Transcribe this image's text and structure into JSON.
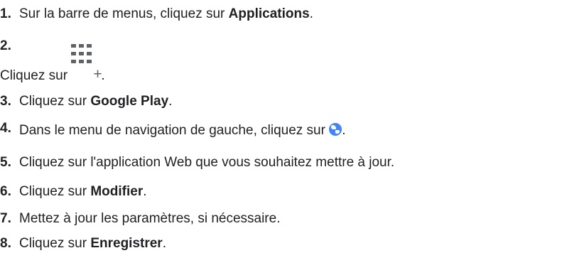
{
  "steps": [
    {
      "num": "1.",
      "pre": "Sur la barre de menus, cliquez sur ",
      "bold": "Applications",
      "post": "."
    },
    {
      "num": "2.",
      "pre": "Cliquez sur ",
      "icon": "apps-grid-plus-icon",
      "post": "."
    },
    {
      "num": "3.",
      "pre": "Cliquez sur ",
      "bold": "Google Play",
      "post": "."
    },
    {
      "num": "4.",
      "pre": "Dans le menu de navigation de gauche, cliquez sur ",
      "icon": "globe-icon",
      "post": "."
    },
    {
      "num": "5.",
      "pre": "Cliquez sur l'application Web que vous souhaitez mettre à jour."
    },
    {
      "num": "6.",
      "pre": "Cliquez sur ",
      "bold": "Modifier",
      "post": "."
    },
    {
      "num": "7.",
      "pre": "Mettez à jour les paramètres, si nécessaire."
    },
    {
      "num": "8.",
      "pre": "Cliquez sur ",
      "bold": "Enregistrer",
      "post": "."
    }
  ],
  "icons": {
    "plus_glyph": "+"
  },
  "colors": {
    "text": "#202124",
    "icon_gray": "#5f6368",
    "globe_blue": "#4285f4"
  }
}
